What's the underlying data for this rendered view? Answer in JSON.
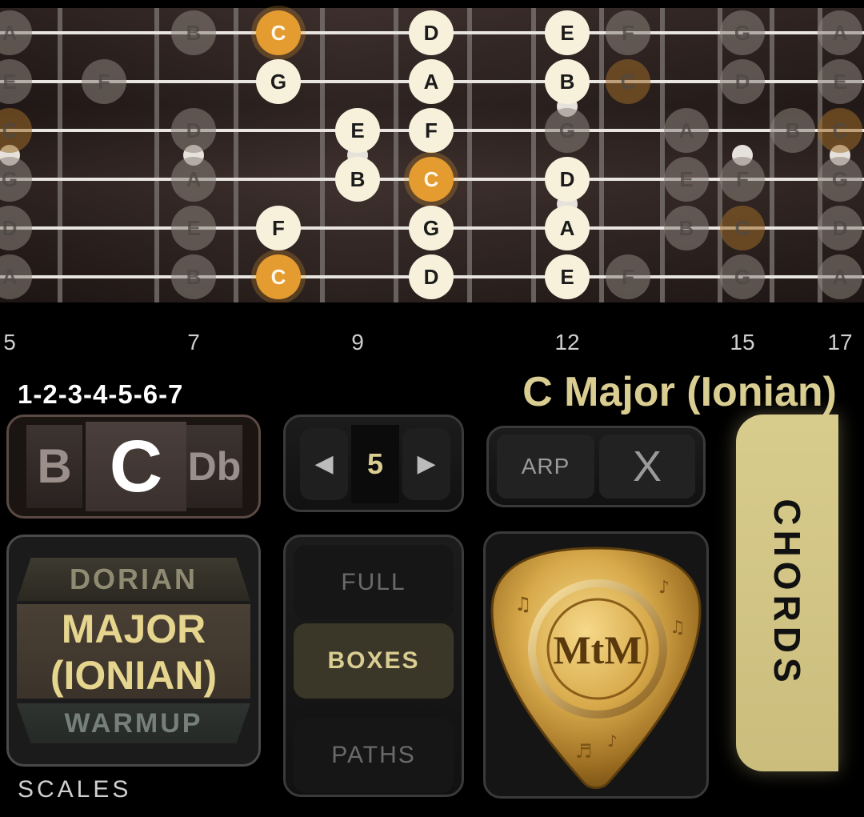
{
  "fretboard": {
    "strings": [
      {
        "notes": [
          {
            "fret": 5,
            "note": "A",
            "state": "dim"
          },
          {
            "fret": 7,
            "note": "B",
            "state": "dim"
          },
          {
            "fret": 8,
            "note": "C",
            "state": "root"
          },
          {
            "fret": 10,
            "note": "D",
            "state": "active"
          },
          {
            "fret": 12,
            "note": "E",
            "state": "active"
          },
          {
            "fret": 13,
            "note": "F",
            "state": "dim"
          },
          {
            "fret": 15,
            "note": "G",
            "state": "dim"
          },
          {
            "fret": 17,
            "note": "A",
            "state": "dim"
          }
        ]
      },
      {
        "notes": [
          {
            "fret": 5,
            "note": "E",
            "state": "dim"
          },
          {
            "fret": 6,
            "note": "F",
            "state": "dim"
          },
          {
            "fret": 8,
            "note": "G",
            "state": "active"
          },
          {
            "fret": 10,
            "note": "A",
            "state": "active"
          },
          {
            "fret": 12,
            "note": "B",
            "state": "active"
          },
          {
            "fret": 13,
            "note": "C",
            "state": "dimroot"
          },
          {
            "fret": 15,
            "note": "D",
            "state": "dim"
          },
          {
            "fret": 17,
            "note": "E",
            "state": "dim"
          }
        ]
      },
      {
        "notes": [
          {
            "fret": 5,
            "note": "C",
            "state": "dimroot"
          },
          {
            "fret": 7,
            "note": "D",
            "state": "dim"
          },
          {
            "fret": 9,
            "note": "E",
            "state": "active"
          },
          {
            "fret": 10,
            "note": "F",
            "state": "active"
          },
          {
            "fret": 12,
            "note": "G",
            "state": "dim"
          },
          {
            "fret": 14,
            "note": "A",
            "state": "dim"
          },
          {
            "fret": 16,
            "note": "B",
            "state": "dim"
          },
          {
            "fret": 17,
            "note": "C",
            "state": "dimroot"
          }
        ]
      },
      {
        "notes": [
          {
            "fret": 5,
            "note": "G",
            "state": "dim"
          },
          {
            "fret": 7,
            "note": "A",
            "state": "dim"
          },
          {
            "fret": 9,
            "note": "B",
            "state": "active"
          },
          {
            "fret": 10,
            "note": "C",
            "state": "root"
          },
          {
            "fret": 12,
            "note": "D",
            "state": "active"
          },
          {
            "fret": 14,
            "note": "E",
            "state": "dim"
          },
          {
            "fret": 15,
            "note": "F",
            "state": "dim"
          },
          {
            "fret": 17,
            "note": "G",
            "state": "dim"
          }
        ]
      },
      {
        "notes": [
          {
            "fret": 5,
            "note": "D",
            "state": "dim"
          },
          {
            "fret": 7,
            "note": "E",
            "state": "dim"
          },
          {
            "fret": 8,
            "note": "F",
            "state": "active"
          },
          {
            "fret": 10,
            "note": "G",
            "state": "active"
          },
          {
            "fret": 12,
            "note": "A",
            "state": "active"
          },
          {
            "fret": 14,
            "note": "B",
            "state": "dim"
          },
          {
            "fret": 15,
            "note": "C",
            "state": "dimroot"
          },
          {
            "fret": 17,
            "note": "D",
            "state": "dim"
          }
        ]
      },
      {
        "notes": [
          {
            "fret": 5,
            "note": "A",
            "state": "dim"
          },
          {
            "fret": 7,
            "note": "B",
            "state": "dim"
          },
          {
            "fret": 8,
            "note": "C",
            "state": "root"
          },
          {
            "fret": 10,
            "note": "D",
            "state": "active"
          },
          {
            "fret": 12,
            "note": "E",
            "state": "active"
          },
          {
            "fret": 13,
            "note": "F",
            "state": "dim"
          },
          {
            "fret": 15,
            "note": "G",
            "state": "dim"
          },
          {
            "fret": 17,
            "note": "A",
            "state": "dim"
          }
        ]
      }
    ],
    "inlay_frets": [
      5,
      7,
      9,
      12,
      15,
      17
    ],
    "colors": {
      "root": "#e49b2f",
      "active": "#f7f1dc",
      "dim": "#8a817a",
      "dimroot": "#9a6a28"
    }
  },
  "fret_numbers": [
    "5",
    "7",
    "9",
    "12",
    "15",
    "17"
  ],
  "formula": "1-2-3-4-5-6-7",
  "scale_title": "C Major (Ionian)",
  "key_selector": {
    "prev": "B",
    "current": "C",
    "next": "Db"
  },
  "position": {
    "value": "5",
    "prev_icon": "triangle-left-icon",
    "next_icon": "triangle-right-icon"
  },
  "arp": {
    "arp_label": "ARP",
    "close_label": "X"
  },
  "chords_label": "CHORDS",
  "mode_selector": {
    "prev": "DORIAN",
    "current_line1": "MAJOR",
    "current_line2": "(IONIAN)",
    "next": "WARMUP"
  },
  "view_modes": {
    "full": "FULL",
    "boxes": "BOXES",
    "paths": "PATHS",
    "selected": "BOXES"
  },
  "scales_label": "SCALES",
  "logo": {
    "text": "MtM"
  },
  "accent_color": "#d9cd91"
}
